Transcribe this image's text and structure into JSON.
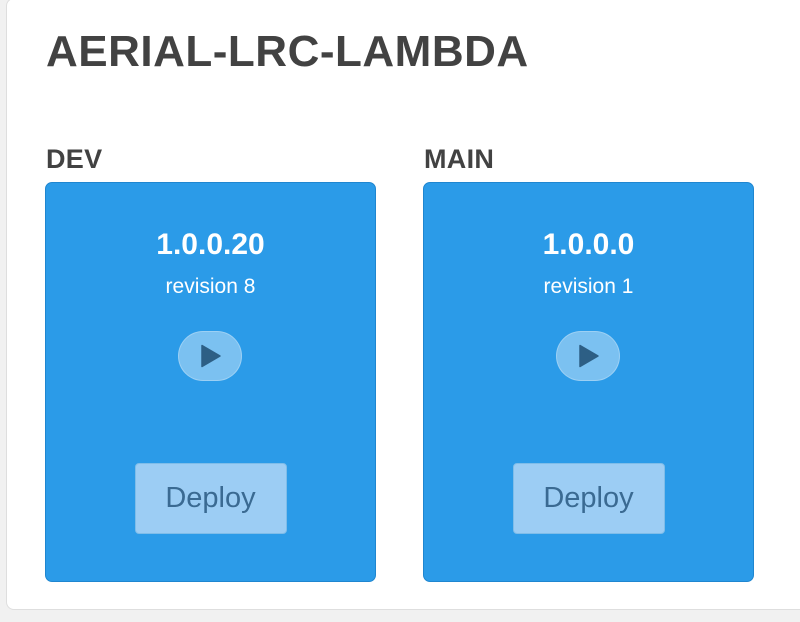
{
  "app": {
    "title": "AERIAL-LRC-LAMBDA"
  },
  "environments": [
    {
      "label": "DEV",
      "version": "1.0.0.20",
      "revision": "revision 8",
      "play_icon": "play-icon",
      "deploy_label": "Deploy"
    },
    {
      "label": "MAIN",
      "version": "1.0.0.0",
      "revision": "revision 1",
      "play_icon": "play-icon",
      "deploy_label": "Deploy"
    }
  ],
  "colors": {
    "card_background": "#2b9be8",
    "deploy_button_background": "#9ccdf4",
    "deploy_button_text": "#3a6a92",
    "play_icon": "#2d5f85",
    "title_text": "#424242"
  }
}
